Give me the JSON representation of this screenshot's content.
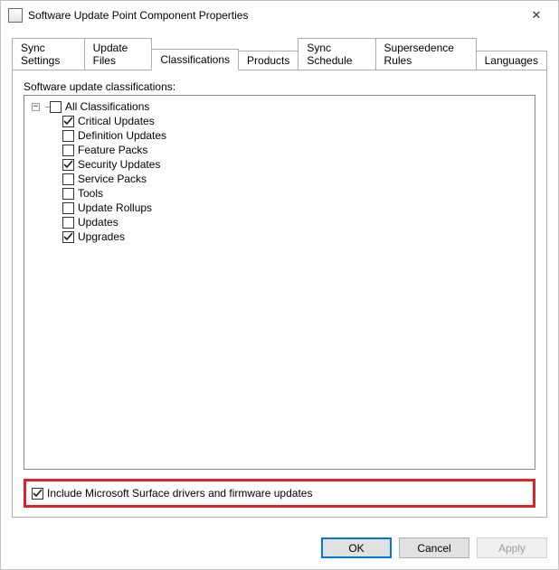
{
  "window": {
    "title": "Software Update Point Component Properties"
  },
  "tabs": [
    {
      "id": "sync-settings",
      "label": "Sync Settings",
      "active": false
    },
    {
      "id": "update-files",
      "label": "Update Files",
      "active": false
    },
    {
      "id": "classifications",
      "label": "Classifications",
      "active": true
    },
    {
      "id": "products",
      "label": "Products",
      "active": false
    },
    {
      "id": "sync-schedule",
      "label": "Sync Schedule",
      "active": false
    },
    {
      "id": "supersedence-rules",
      "label": "Supersedence Rules",
      "active": false
    },
    {
      "id": "languages",
      "label": "Languages",
      "active": false
    }
  ],
  "classifications_page": {
    "heading": "Software update classifications:",
    "root": {
      "label": "All Classifications",
      "checked": false,
      "expanded": true
    },
    "children": [
      {
        "label": "Critical Updates",
        "checked": true
      },
      {
        "label": "Definition Updates",
        "checked": false
      },
      {
        "label": "Feature Packs",
        "checked": false
      },
      {
        "label": "Security Updates",
        "checked": true
      },
      {
        "label": "Service Packs",
        "checked": false
      },
      {
        "label": "Tools",
        "checked": false
      },
      {
        "label": "Update Rollups",
        "checked": false
      },
      {
        "label": "Updates",
        "checked": false
      },
      {
        "label": "Upgrades",
        "checked": true
      }
    ],
    "include_surface": {
      "label": "Include Microsoft Surface drivers and firmware updates",
      "checked": true
    }
  },
  "footer": {
    "ok": "OK",
    "cancel": "Cancel",
    "apply": "Apply"
  },
  "glyphs": {
    "close": "✕",
    "minus": "−"
  }
}
